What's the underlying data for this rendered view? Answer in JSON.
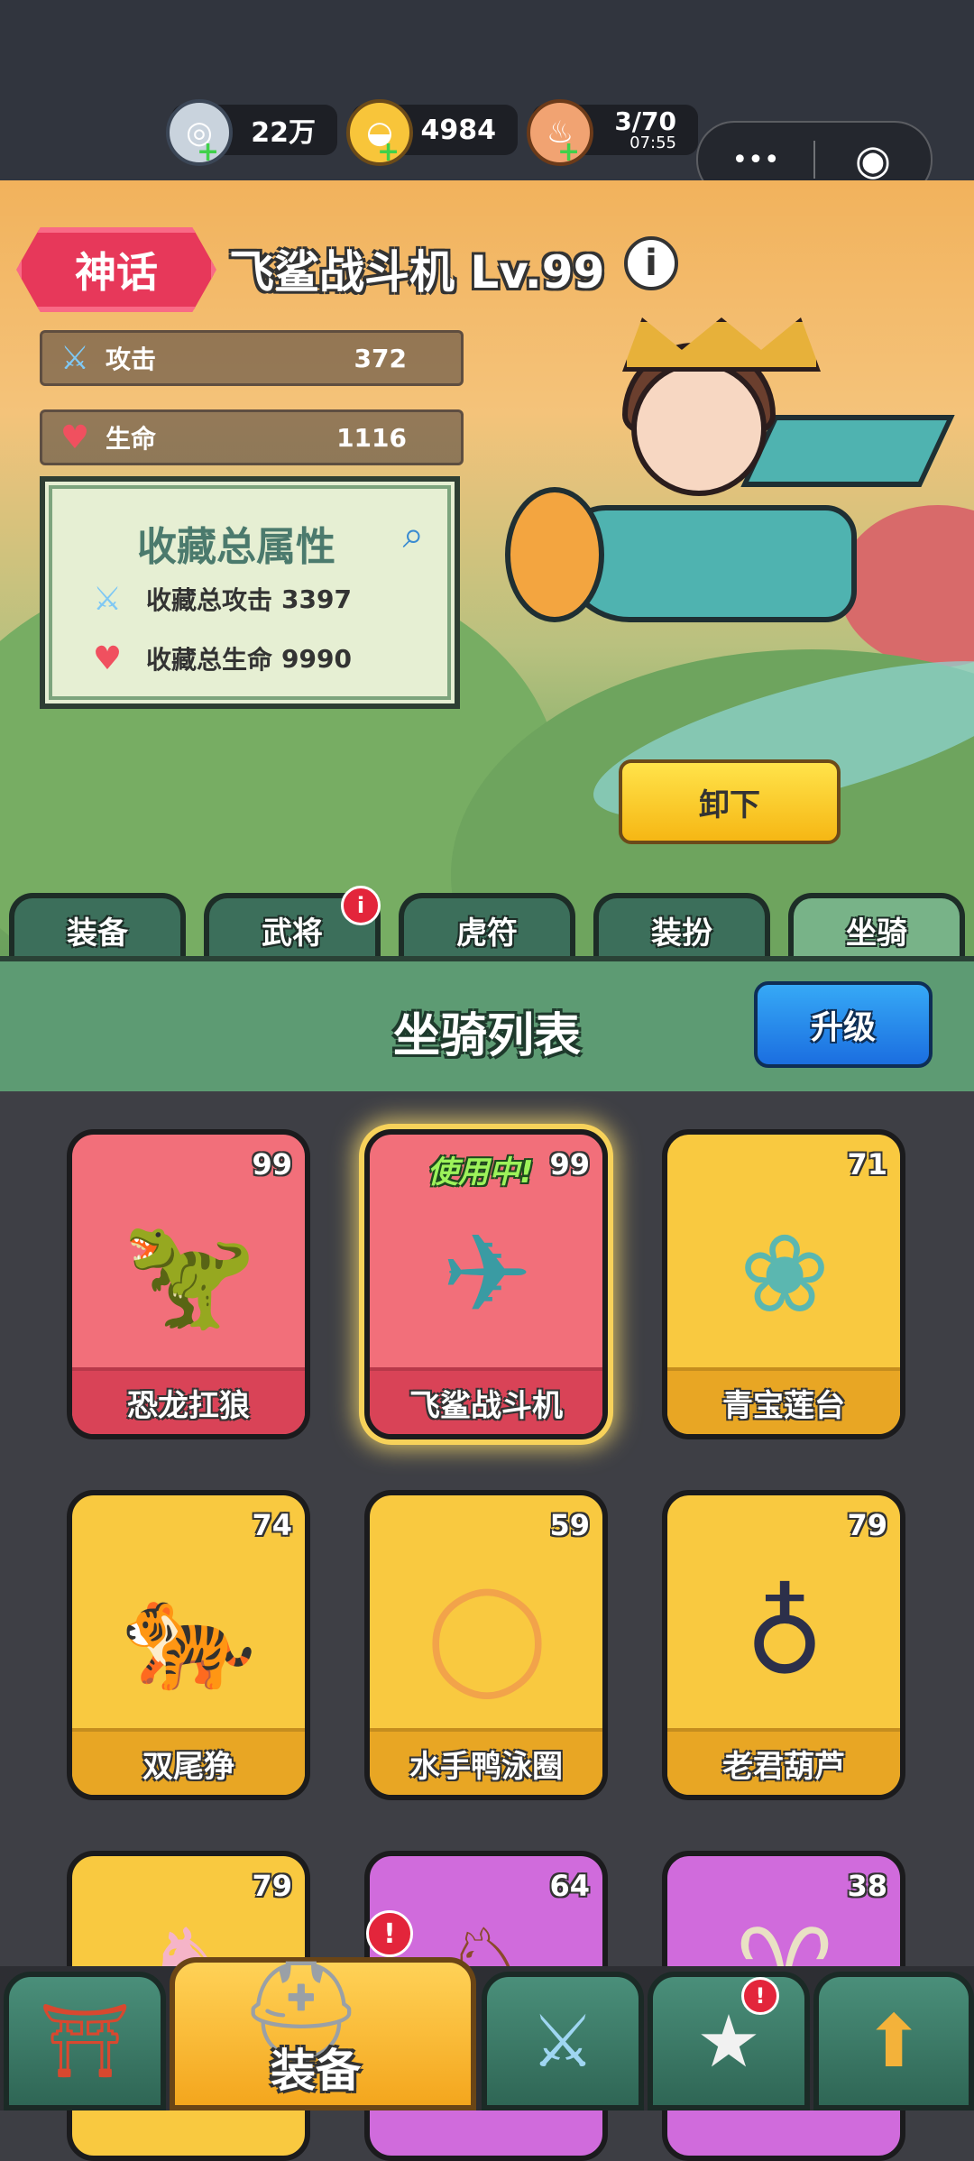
{
  "currencies": [
    {
      "icon": "silver-coin-icon",
      "value": "22万"
    },
    {
      "icon": "gold-ingot-icon",
      "value": "4984"
    },
    {
      "icon": "meat-drumstick-icon",
      "value": "3/70",
      "timer": "07:55"
    }
  ],
  "capsule": {
    "more": "•••",
    "close": "◉"
  },
  "hero": {
    "rank": "神话",
    "title": "飞鲨战斗机 Lv.99",
    "info": "i",
    "stats": [
      {
        "label": "攻击",
        "value": "372"
      },
      {
        "label": "生命",
        "value": "1116"
      }
    ],
    "collection": {
      "title": "收藏总属性",
      "rows": [
        {
          "label": "收藏总攻击",
          "value": "3397"
        },
        {
          "label": "收藏总生命",
          "value": "9990"
        }
      ]
    },
    "unload_label": "卸下"
  },
  "tabs": [
    {
      "label": "装备"
    },
    {
      "label": "武将",
      "dot": "i"
    },
    {
      "label": "虎符"
    },
    {
      "label": "装扮"
    },
    {
      "label": "坐骑"
    }
  ],
  "list": {
    "title": "坐骑列表",
    "upgrade_label": "升级"
  },
  "mounts": [
    {
      "name": "恐龙扛狼",
      "level": "99",
      "rarity": "red"
    },
    {
      "name": "飞鲨战斗机",
      "level": "99",
      "rarity": "red",
      "status": "使用中!"
    },
    {
      "name": "青宝莲台",
      "level": "71",
      "rarity": "gold"
    },
    {
      "name": "双尾狰",
      "level": "74",
      "rarity": "gold"
    },
    {
      "name": "水手鸭泳圈",
      "level": "59",
      "rarity": "gold"
    },
    {
      "name": "老君葫芦",
      "level": "79",
      "rarity": "gold"
    },
    {
      "name": "",
      "level": "79",
      "rarity": "gold"
    },
    {
      "name": "",
      "level": "64",
      "rarity": "purple"
    },
    {
      "name": "",
      "level": "38",
      "rarity": "purple"
    }
  ],
  "nav": {
    "active_label": "装备",
    "badge": "!"
  },
  "colors": {
    "accent_red": "#e3253b",
    "tab_active": "#78b388",
    "button_yellow": "#f6b714",
    "button_blue": "#1b6ee0"
  }
}
